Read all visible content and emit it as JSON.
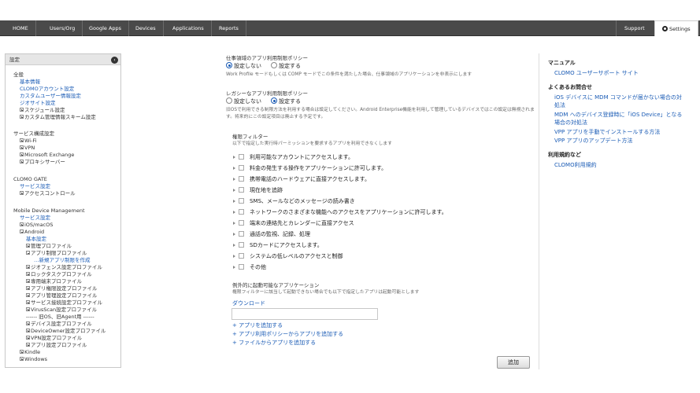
{
  "topnav": {
    "home": "HOME",
    "users_org": "Users/Org",
    "google_apps": "Google Apps",
    "devices": "Devices",
    "applications": "Applications",
    "reports": "Reports",
    "support": "Support",
    "settings": "Settings"
  },
  "sidebar": {
    "header": "設定",
    "collapse_icon": "chevron-left-icon",
    "groups": {
      "general": {
        "title": "全般",
        "basic_info": "基本情報",
        "clomo_account": "CLOMOアカウント設定",
        "custom_user_info": "カスタムユーザー情報設定",
        "geo_site": "ジオサイト設定",
        "schedule": "スケジュール設定",
        "custom_scheme": "カスタム管理情報スキーム設定"
      },
      "service_config": {
        "title": "サービス構成設定",
        "wifi": "Wi-Fi",
        "vpn": "VPN",
        "exchange": "Microsoft Exchange",
        "proxy": "プロキシサーバー"
      },
      "clomo_gate": {
        "title": "CLOMO GATE",
        "service_settings": "サービス設定",
        "access_control": "アクセスコントロール"
      },
      "mdm": {
        "title": "Mobile Device Management",
        "service_settings": "サービス設定",
        "ios_macos": "iOS/macOS",
        "android": "Android",
        "basic_settings": "基本設定",
        "managed_profile": "管理プロファイル",
        "app_restriction_profile": "アプリ制限プロファイル",
        "new_app_restriction": "…新規アプリ制限を作成",
        "geofence_profile": "ジオフェンス設定プロファイル",
        "lock_task_profile": "ロックタスクプロファイル",
        "dedicated_device_profile": "専用端末プロファイル",
        "app_permission_profile": "アプリ権限設定プロファイル",
        "app_management_profile": "アプリ管理設定プロファイル",
        "service_connection_profile": "サービス接続設定プロファイル",
        "virusscan_profile": "VirusScan設定プロファイル",
        "old_os_separator": "------ 旧OS、旧Agent用 ------",
        "device_profile": "デバイス設定プロファイル",
        "device_owner_profile": "DeviceOwner設定プロファイル",
        "vpn_profile": "VPN設定プロファイル",
        "app_settings_profile": "アプリ設定プロファイル",
        "kindle": "Kindle",
        "windows": "Windows"
      }
    }
  },
  "main": {
    "work_policy": {
      "title": "仕事領域のアプリ利用制限ポリシー",
      "opt_off": "設定しない",
      "opt_on": "設定する",
      "selected": "設定しない",
      "desc": "Work Profile モードもしくは COMP モードでこの条件を満たした場合、仕事領域のアプリケーションを非表示にします"
    },
    "legacy_policy": {
      "title": "レガシーなアプリ利用制限ポリシー",
      "opt_off": "設定しない",
      "opt_on": "設定する",
      "selected": "設定する",
      "desc": "旧OSで利用できる制限方法を利用する場合は設定してください。Android Enterprise機能を利用して管理しているデバイスではこの設定は無視されます。将来的にこの設定項目は廃止する予定です。"
    },
    "permission_filter": {
      "title": "権限フィルター",
      "desc": "以下で指定した実行時パーミッションを要求するアプリを利用できなくします",
      "items": [
        "利用可能なアカウントにアクセスします。",
        "料金の発生する操作をアプリケーションに許可します。",
        "携帯電話のハードウェアに直接アクセスします。",
        "現在地を追跡",
        "SMS、メールなどのメッセージの読み書き",
        "ネットワークのさまざまな機能へのアクセスをアプリケーションに許可します。",
        "端末の連絡先とカレンダーに直接アクセス",
        "通話の監視、記録、処理",
        "SDカードにアクセスします。",
        "システムの低レベルのアクセスと制御",
        "その他"
      ]
    },
    "exceptions": {
      "title": "例外的に起動可能なアプリケーション",
      "desc": "権限フィルターに該当して起動できない場合でも以下で指定したアプリは起動可能とします",
      "download_link": "ダウンロード",
      "input_value": "",
      "add_app": "+ アプリを追加する",
      "add_from_policy": "+ アプリ利用ポリシーからアプリを追加する",
      "add_from_file": "+ ファイルからアプリを追加する"
    },
    "submit_label": "追加"
  },
  "right": {
    "manual_title": "マニュアル",
    "manual_link": "CLOMO ユーザーサポート サイト",
    "faq_title": "よくあるお問合せ",
    "faq_1": "iOS デバイスに MDM コマンドが届かない場合の対",
    "faq_1b": "処法",
    "faq_2": "MDM へのデバイス登録時に「iOS Device」となる",
    "faq_2b": "場合の対処法",
    "faq_3": "VPP アプリを手動でインストールする方法",
    "faq_4": "VPP アプリのアップデート方法",
    "terms_title": "利用規約など",
    "terms_link": "CLOMO利用規約"
  }
}
